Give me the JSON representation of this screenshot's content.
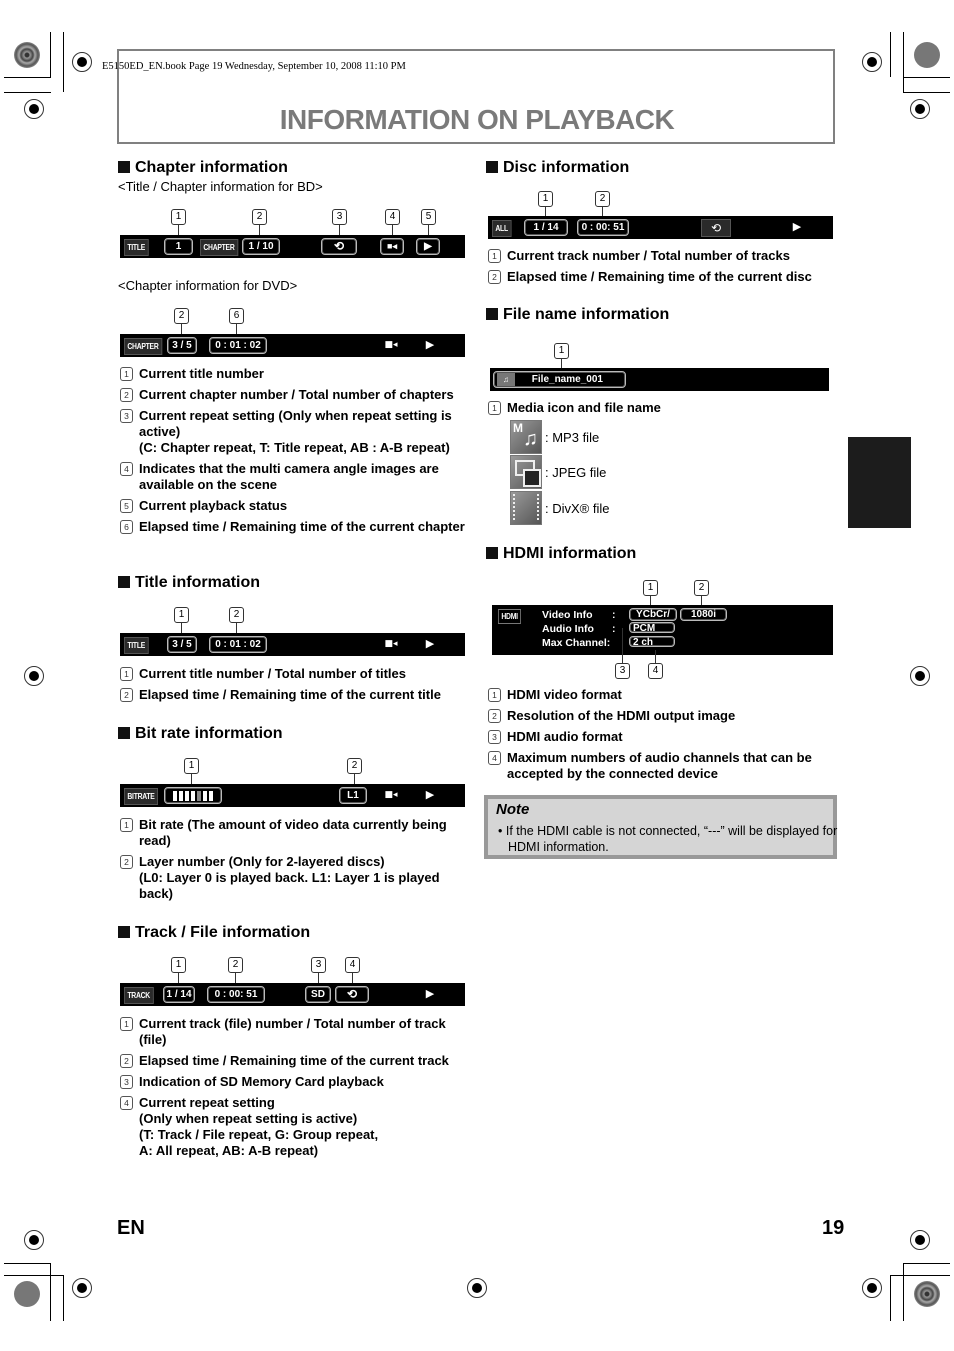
{
  "header": {
    "meta": "E5150ED_EN.book  Page 19  Wednesday, September 10, 2008  11:10 PM",
    "title": "INFORMATION ON PLAYBACK"
  },
  "chapter": {
    "heading": "Chapter information",
    "bd_caption": "<Title / Chapter information for BD>",
    "bd_osd": {
      "title_label": "TITLE",
      "title_value": "1",
      "chapter_label": "CHAPTER",
      "chapter_value": "1 / 10",
      "repeat_icon": "repeat-icon",
      "angle_icon": "camera-angle-icon",
      "status_icon": "play-icon",
      "status_glyph": "▶"
    },
    "bd_callouts": [
      "1",
      "2",
      "3",
      "4",
      "5"
    ],
    "dvd_caption": "<Chapter information for DVD>",
    "dvd_osd": {
      "chapter_label": "CHAPTER",
      "chapter_value": "3 / 5",
      "time_value": "0 : 01 : 02",
      "status_glyph": "▶"
    },
    "dvd_callouts": [
      "2",
      "6"
    ],
    "items": [
      {
        "num": "1",
        "text": "Current title number"
      },
      {
        "num": "2",
        "text": "Current chapter number / Total number of chapters"
      },
      {
        "num": "3",
        "text": "Current repeat setting (Only when repeat setting is active)",
        "text2": "(C: Chapter repeat, T: Title repeat, AB : A-B repeat)"
      },
      {
        "num": "4",
        "text": "Indicates that the multi camera angle images are available on the scene"
      },
      {
        "num": "5",
        "text": "Current playback status"
      },
      {
        "num": "6",
        "text": "Elapsed time / Remaining time of the current chapter"
      }
    ]
  },
  "title_info": {
    "heading": "Title information",
    "osd": {
      "title_label": "TITLE",
      "title_value": "3 / 5",
      "time_value": "0 : 01 : 02",
      "status_glyph": "▶"
    },
    "callouts": [
      "1",
      "2"
    ],
    "items": [
      {
        "num": "1",
        "text": "Current title number / Total number of titles"
      },
      {
        "num": "2",
        "text": "Elapsed time / Remaining time of the current title"
      }
    ]
  },
  "bitrate": {
    "heading": "Bit rate information",
    "osd": {
      "label": "BITRATE",
      "segments_total": 7,
      "segments_highlight_index": 4,
      "layer_value": "L1",
      "status_glyph": "▶"
    },
    "callouts": [
      "1",
      "2"
    ],
    "items": [
      {
        "num": "1",
        "text": "Bit rate (The amount of video data currently being read)"
      },
      {
        "num": "2",
        "text": "Layer number (Only for 2-layered discs)",
        "text2": "(L0: Layer 0 is played back. L1: Layer 1 is played back)"
      }
    ]
  },
  "track": {
    "heading": "Track / File information",
    "osd": {
      "label": "TRACK",
      "track_value": "1 / 14",
      "time_value": "0 : 00: 51",
      "sd_value": "SD",
      "status_glyph": "▶"
    },
    "callouts": [
      "1",
      "2",
      "3",
      "4"
    ],
    "items": [
      {
        "num": "1",
        "text": "Current track (file) number / Total number of track (file)"
      },
      {
        "num": "2",
        "text": "Elapsed time / Remaining time of the current track"
      },
      {
        "num": "3",
        "text": "Indication of SD Memory Card playback"
      },
      {
        "num": "4",
        "text": "Current repeat setting",
        "text2": "(Only when repeat setting is active)",
        "text3": "(T: Track / File repeat, G: Group repeat,",
        "text4": "A: All repeat, AB: A-B repeat)"
      }
    ]
  },
  "disc": {
    "heading": "Disc information",
    "osd": {
      "label": "ALL",
      "track_value": "1 / 14",
      "time_value": "0 : 00: 51",
      "status_glyph": "▶"
    },
    "callouts": [
      "1",
      "2"
    ],
    "items": [
      {
        "num": "1",
        "text": "Current track number / Total number of tracks"
      },
      {
        "num": "2",
        "text": "Elapsed time / Remaining time of the current disc"
      }
    ]
  },
  "filename": {
    "heading": "File name information",
    "osd": {
      "file_name": "File_name_001"
    },
    "callouts": [
      "1"
    ],
    "items": [
      {
        "num": "1",
        "text": "Media icon and file name"
      }
    ],
    "media": [
      {
        "icon": "mp3-file-icon",
        "label": ": MP3 file"
      },
      {
        "icon": "jpeg-file-icon",
        "label": ": JPEG file"
      },
      {
        "icon": "divx-file-icon",
        "label": ": DivX® file"
      }
    ]
  },
  "hdmi": {
    "heading": "HDMI information",
    "osd": {
      "label": "HDMI",
      "video_label": "Video Info",
      "audio_label": "Audio Info",
      "channel_label": "Max Channel",
      "colon": ":",
      "video_format": "YCbCr/",
      "resolution": "1080i",
      "audio_format": "PCM",
      "channels": "2 ch"
    },
    "callouts": [
      "1",
      "2",
      "3",
      "4"
    ],
    "items": [
      {
        "num": "1",
        "text": "HDMI video format"
      },
      {
        "num": "2",
        "text": "Resolution of the HDMI output image"
      },
      {
        "num": "3",
        "text": "HDMI audio format"
      },
      {
        "num": "4",
        "text": "Maximum numbers of audio channels that can be accepted by the connected device"
      }
    ]
  },
  "note": {
    "title": "Note",
    "text": "• If the HDMI cable is not connected, “---” will be displayed for HDMI information."
  },
  "footer": {
    "lang": "EN",
    "page": "19"
  }
}
